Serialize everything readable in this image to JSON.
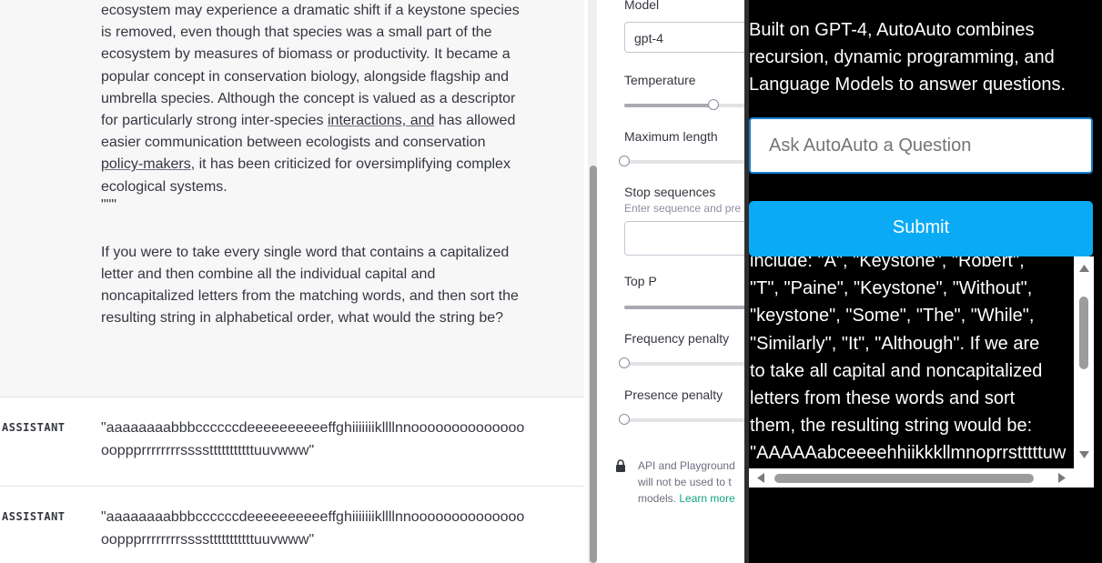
{
  "chat": {
    "prompt": {
      "line1": "ecosystem may experience a dramatic shift if a keystone species is removed, even though that species was a small part of the ecosystem by measures of biomass or productivity. It became a popular concept in conservation biology, alongside flagship and umbrella species. Although the concept is valued as a descriptor for particularly strong inter-species ",
      "underline1": "interactions, and",
      "line2": " has allowed easier communication between ecologists and conservation ",
      "underline2": "policy-makers",
      "line3": ", it has been criticized for oversimplifying complex ecological systems.",
      "quotes": "\"\"\"",
      "question": "If you were to take every single word that contains a capitalized letter and then combine all the individual capital and noncapitalized letters from the matching words, and then sort the resulting string in alphabetical order, what would the string be?"
    },
    "responses": [
      {
        "role": "ASSISTANT",
        "text": "\"aaaaaaaabbbccccccdeeeeeeeeeeffghiiiiiiikllllnnooooooooooooooooppprrrrrrrrsssstttttttttttuuvwww\""
      },
      {
        "role": "ASSISTANT",
        "text": "\"aaaaaaaabbbccccccdeeeeeeeeeeffghiiiiiiikllllnnooooooooooooooooppprrrrrrrrsssstttttttttttuuvwww\""
      }
    ]
  },
  "settings": {
    "model_label": "Model",
    "model_value": "gpt-4",
    "temperature_label": "Temperature",
    "temperature_value": 0.7,
    "max_length_label": "Maximum length",
    "max_length_value": 0,
    "stop_label": "Stop sequences",
    "stop_hint": "Enter sequence and pre",
    "top_p_label": "Top P",
    "top_p_value": 1,
    "freq_label": "Frequency penalty",
    "freq_value": 0,
    "presence_label": "Presence penalty",
    "presence_value": 0,
    "api_note_1": "API and Playground",
    "api_note_2": "will not be used to t",
    "api_note_3": "models.",
    "learn_more": "Learn more"
  },
  "overlay": {
    "intro": "Built on GPT-4, AutoAuto combines recursion, dynamic programming, and Language Models to answer questions.",
    "input_placeholder": "Ask AutoAuto a Question",
    "submit_label": "Submit",
    "answer": {
      "l1": "include: \"A\", \"Keystone\", \"Robert\",",
      "l2": "\"T\", \"Paine\", \"Keystone\", \"Without\",",
      "l3": "\"keystone\", \"Some\", \"The\", \"While\",",
      "l4": "\"Similarly\", \"It\", \"Although\". If we are",
      "l5": "to take all capital and noncapitalized",
      "l6": "letters from these words and sort",
      "l7": "them, the resulting string would be:",
      "l8": "\"AAAAAabceeeehhiikkkllmnoprrstttttuw"
    }
  },
  "colors": {
    "accent_submit": "#0baaf4",
    "input_border": "#1a7fd0",
    "link": "#10a37f"
  }
}
